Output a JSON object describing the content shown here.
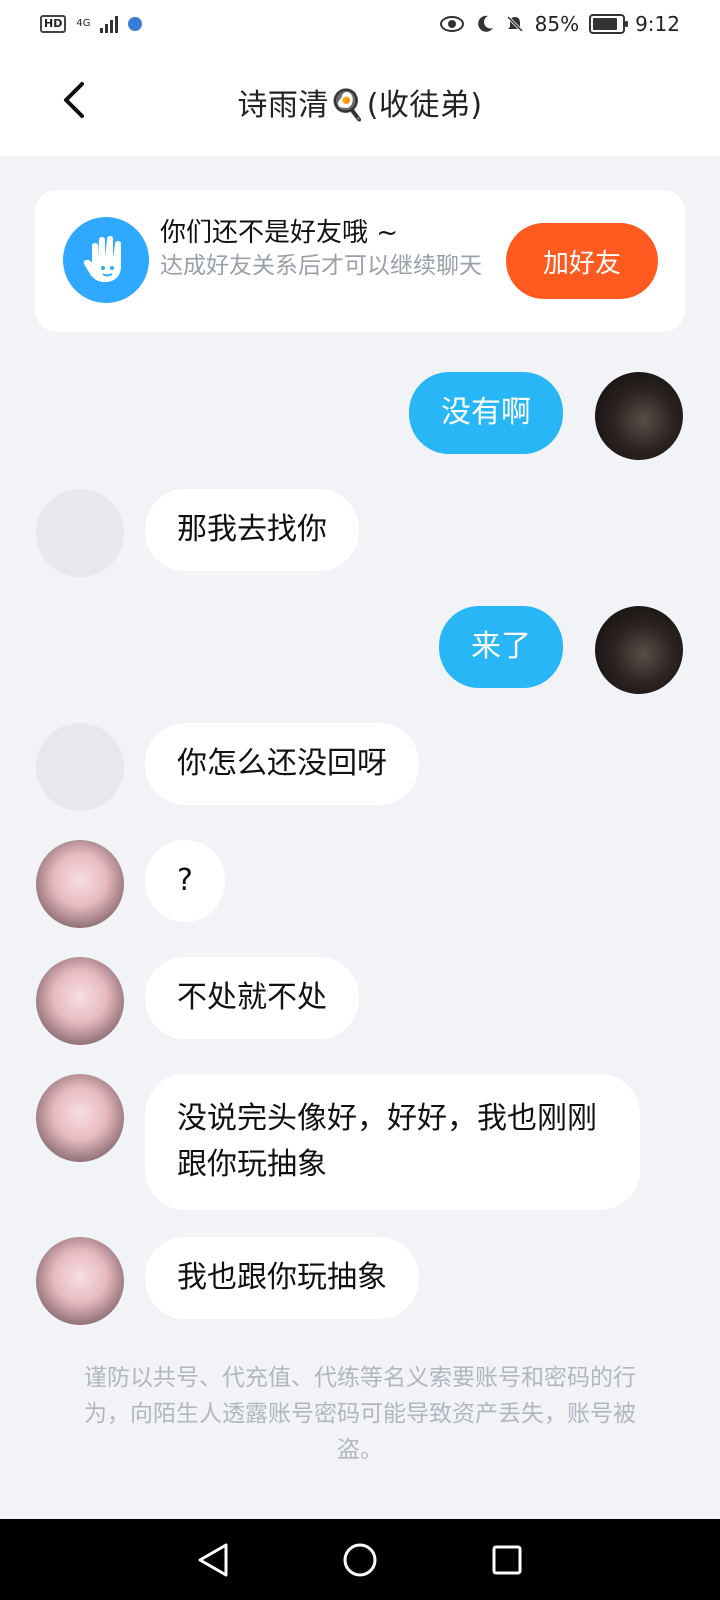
{
  "status_bar": {
    "network": "4G",
    "battery": "85%",
    "time": "9:12"
  },
  "header": {
    "title": "诗雨清🍳(收徒弟)"
  },
  "friend_card": {
    "title": "你们还不是好友哦 ~",
    "subtitle": "达成好友关系后才可以继续聊天",
    "add_button": "加好友"
  },
  "messages": [
    {
      "side": "out",
      "avatar": "dark",
      "text": "没有啊"
    },
    {
      "side": "in",
      "avatar": "blank",
      "text": "那我去找你"
    },
    {
      "side": "out",
      "avatar": "dark",
      "text": "来了"
    },
    {
      "side": "in",
      "avatar": "blank",
      "text": "你怎么还没回呀"
    },
    {
      "side": "in",
      "avatar": "anime",
      "text": "?"
    },
    {
      "side": "in",
      "avatar": "anime",
      "text": "不处就不处"
    },
    {
      "side": "in",
      "avatar": "anime",
      "text": "没说完头像好，好好，我也刚刚跟你玩抽象"
    },
    {
      "side": "in",
      "avatar": "anime",
      "text": "我也跟你玩抽象"
    }
  ],
  "notice": "谨防以共号、代充值、代练等名义索要账号和密码的行为，向陌生人透露账号密码可能导致资产丢失，账号被盗。",
  "icons": {
    "back": "back-arrow-icon",
    "hand": "hand-wave-icon",
    "nav_back": "triangle-back-icon",
    "nav_home": "circle-home-icon",
    "nav_recent": "square-recent-icon"
  },
  "colors": {
    "accent_blue": "#29b6f6",
    "add_button": "#ff5a1f",
    "background": "#f1f3f7"
  }
}
